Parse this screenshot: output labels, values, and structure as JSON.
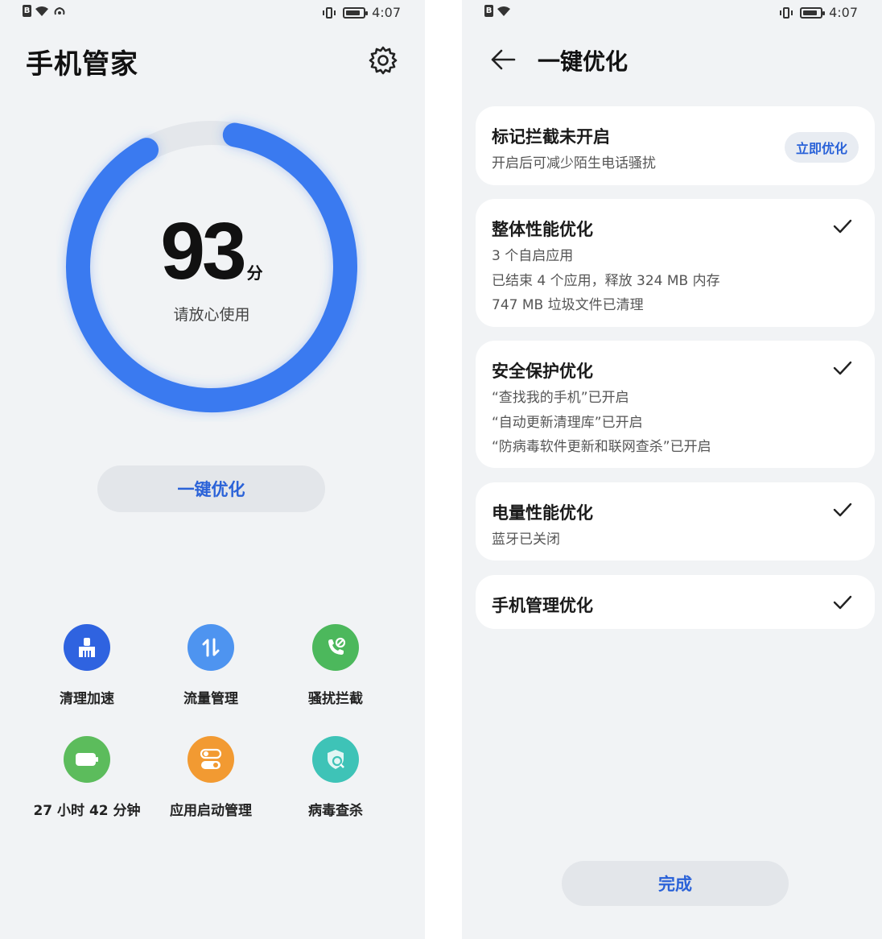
{
  "left": {
    "status": {
      "time": "4:07"
    },
    "title": "手机管家",
    "score": {
      "value": "93",
      "unit": "分",
      "message": "请放心使用",
      "fraction": 0.93,
      "color": "#3a7af0"
    },
    "optimize_label": "一键优化",
    "tools": [
      {
        "label": "清理加速",
        "icon": "broom-icon",
        "color": "#2f63e0"
      },
      {
        "label": "流量管理",
        "icon": "data-transfer-icon",
        "color": "#4e94f0"
      },
      {
        "label": "骚扰拦截",
        "icon": "phone-block-icon",
        "color": "#4cb85c"
      },
      {
        "label": "27 小时 42 分钟",
        "icon": "battery-icon",
        "color": "#5cbc5c"
      },
      {
        "label": "应用启动管理",
        "icon": "toggle-icon",
        "color": "#f29a32"
      },
      {
        "label": "病毒查杀",
        "icon": "shield-scan-icon",
        "color": "#3ec3b7"
      }
    ]
  },
  "right": {
    "status": {
      "time": "4:07"
    },
    "title": "一键优化",
    "cards": [
      {
        "title": "标记拦截未开启",
        "lines": [
          "开启后可减少陌生电话骚扰"
        ],
        "action": "立即优化"
      },
      {
        "title": "整体性能优化",
        "lines": [
          "3 个自启应用",
          "已结束 4 个应用，释放 324 MB 内存",
          "747 MB 垃圾文件已清理"
        ]
      },
      {
        "title": "安全保护优化",
        "lines": [
          "“查找我的手机”已开启",
          "“自动更新清理库”已开启",
          "“防病毒软件更新和联网查杀”已开启"
        ]
      },
      {
        "title": "电量性能优化",
        "lines": [
          "蓝牙已关闭"
        ]
      },
      {
        "title": "手机管理优化",
        "lines": []
      }
    ],
    "done_label": "完成"
  },
  "colors": {
    "accent": "#2a62d8",
    "background": "#f1f3f5",
    "card": "#ffffff"
  }
}
